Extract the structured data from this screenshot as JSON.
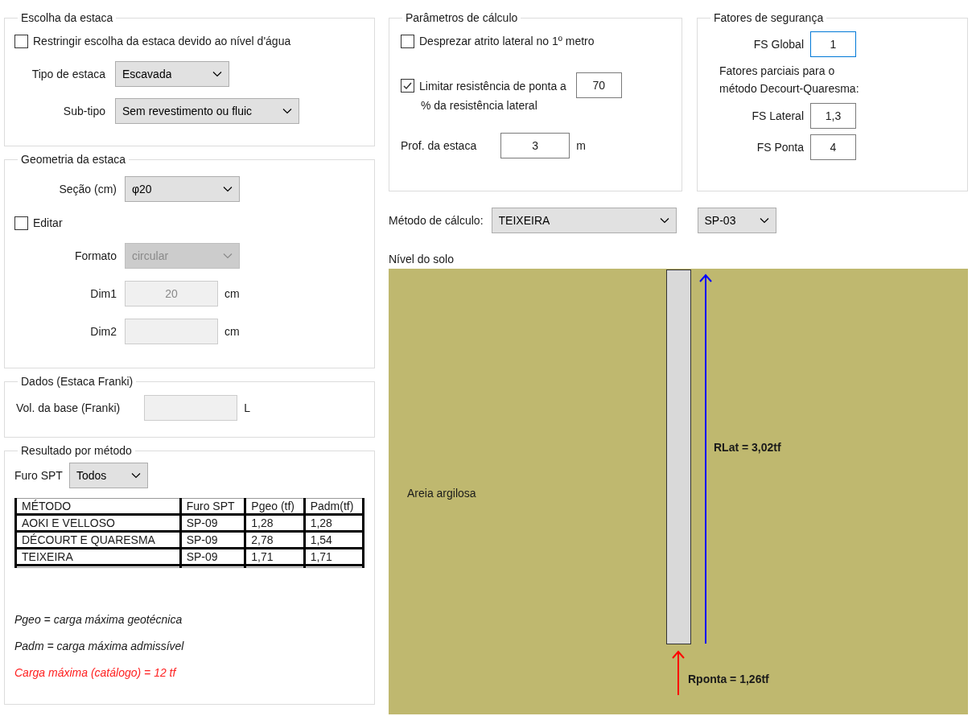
{
  "pile_choice": {
    "title": "Escolha da estaca",
    "restrict": {
      "label": "Restringir escolha da estaca devido ao nível d'água",
      "checked": false
    },
    "fields": [
      {
        "label": "Tipo de estaca",
        "value": "Escavada",
        "disabled": false
      },
      {
        "label": "Sub-tipo",
        "value": "Sem revestimento ou fluic",
        "disabled": false
      }
    ]
  },
  "geometry": {
    "title": "Geometria da estaca",
    "section": {
      "label": "Seção (cm)",
      "value": "φ20",
      "disabled": false
    },
    "edit": {
      "label": "Editar",
      "checked": false
    },
    "shape": {
      "label": "Formato",
      "value": "circular",
      "disabled": true
    },
    "dims": [
      {
        "label": "Dim1",
        "value": "20",
        "unit": "cm",
        "disabled": true
      },
      {
        "label": "Dim2",
        "unit": "cm",
        "disabled": true
      }
    ]
  },
  "franki": {
    "title": "Dados (Estaca Franki)",
    "label": "Vol. da base (Franki)",
    "unit": "L",
    "disabled": true
  },
  "results": {
    "title": "Resultado por método",
    "filter": {
      "label": "Furo SPT",
      "value": "Todos"
    },
    "table": {
      "columns": [
        "MÉTODO",
        "Furo SPT",
        "Pgeo (tf)",
        "Padm(tf)"
      ],
      "rows": [
        [
          "AOKI E VELLOSO",
          "SP-09",
          "1,28",
          "1,28"
        ],
        [
          "DÉCOURT E QUARESMA",
          "SP-09",
          "2,78",
          "1,54"
        ],
        [
          "TEIXEIRA",
          "SP-09",
          "1,71",
          "1,71"
        ]
      ]
    },
    "notes": [
      {
        "text": "Pgeo = carga máxima geotécnica",
        "kind": "normal"
      },
      {
        "text": "Padm = carga máxima admissível",
        "kind": "normal"
      },
      {
        "text": "Carga máxima (catálogo) = 12 tf",
        "kind": "warning"
      }
    ]
  },
  "params": {
    "title": "Parâmetros de cálculo",
    "ignore_friction": {
      "label": "Desprezar atrito lateral no 1º metro",
      "checked": false
    },
    "limit_tip": {
      "label": "Limitar resistência de ponta a",
      "label_2": "% da resistência lateral",
      "checked": true,
      "value": "70"
    },
    "depth": {
      "label": "Prof. da estaca",
      "value": "3",
      "unit": "m"
    }
  },
  "safety": {
    "title": "Fatores de segurança",
    "global": {
      "label": "FS Global",
      "value": "1",
      "focused": true
    },
    "note": "Fatores parciais para o método Decourt-Quaresma:",
    "partials": [
      {
        "label": "FS Lateral",
        "value": "1,3"
      },
      {
        "label": "FS Ponta",
        "value": "4"
      }
    ]
  },
  "method": {
    "label": "Método de cálculo:",
    "value": "TEIXEIRA",
    "boring": "SP-03"
  },
  "soil": {
    "title": "Nível do solo",
    "layer": "Areia argilosa",
    "lateral": "RLat = 3,02tf",
    "tip": "Rponta = 1,26tf"
  }
}
